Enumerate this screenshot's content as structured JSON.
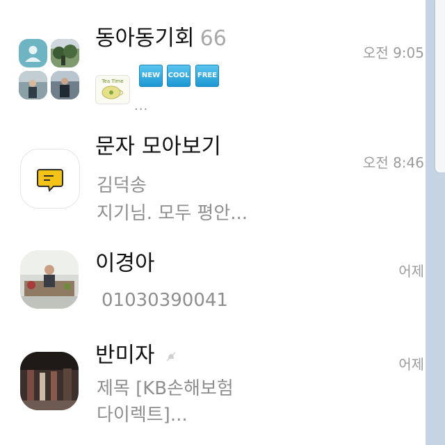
{
  "conversations": [
    {
      "title": "동아동기회",
      "member_count": "66",
      "time": "오전 9:05",
      "sticker_tags": [
        "NEW",
        "COOL",
        "FREE"
      ],
      "sticker_label": "Tea Time",
      "preview": "..."
    },
    {
      "title": "문자 모아보기",
      "time": "오전 8:46",
      "preview_line1": "김덕송",
      "preview_line2": "지기님. 모두 평안..."
    },
    {
      "title": "이경아",
      "time": "어제",
      "preview_line1": "01030390041"
    },
    {
      "title": "반미자",
      "time": "어제",
      "preview_line1": "제목 [KB손해보험",
      "preview_line2": "다이렉트]..."
    }
  ],
  "colors": {
    "scrollbar_track": "#c5d3e3",
    "message_icon_yellow": "#f3c316",
    "tag_blue": "#2aa7de"
  }
}
